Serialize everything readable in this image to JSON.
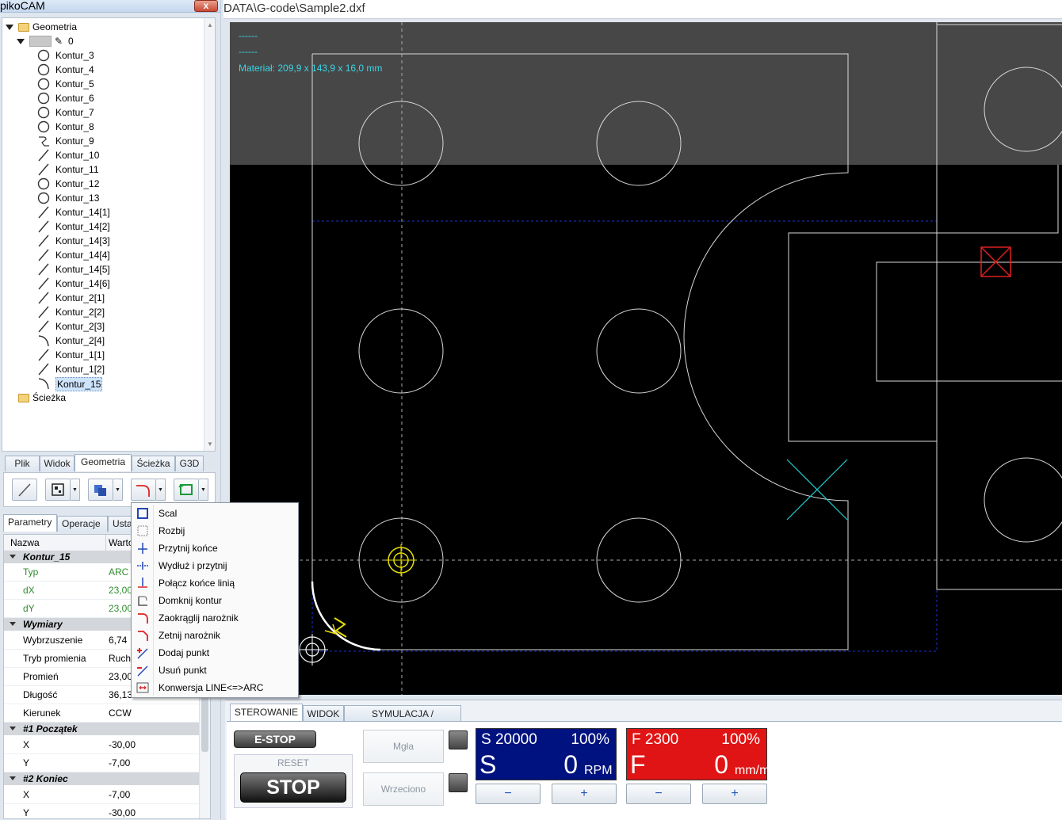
{
  "app": {
    "title": "pikoCAM",
    "close_label": "x"
  },
  "path": "DATA\\G-code\\Sample2.dxf",
  "tree": {
    "root": "Geometria",
    "layer": "0",
    "items": [
      "Kontur_3",
      "Kontur_4",
      "Kontur_5",
      "Kontur_6",
      "Kontur_7",
      "Kontur_8",
      "Kontur_9",
      "Kontur_10",
      "Kontur_11",
      "Kontur_12",
      "Kontur_13",
      "Kontur_14[1]",
      "Kontur_14[2]",
      "Kontur_14[3]",
      "Kontur_14[4]",
      "Kontur_14[5]",
      "Kontur_14[6]",
      "Kontur_2[1]",
      "Kontur_2[2]",
      "Kontur_2[3]",
      "Kontur_2[4]",
      "Kontur_1[1]",
      "Kontur_1[2]",
      "Kontur_15"
    ],
    "item_icons": [
      "circle",
      "circle",
      "circle",
      "circle",
      "circle",
      "circle",
      "path",
      "line",
      "line",
      "circle",
      "circle",
      "line",
      "line",
      "line",
      "line",
      "line",
      "line",
      "line",
      "line",
      "line",
      "arc",
      "line",
      "line",
      "arc"
    ],
    "selected": "Kontur_15",
    "second_root": "Ścieżka"
  },
  "top_tabs": [
    "Plik",
    "Widok",
    "Geometria",
    "Ścieżka",
    "G3D"
  ],
  "top_tab_active": "Geometria",
  "prop_tabs": [
    "Parametry",
    "Operacje",
    "Ustaw"
  ],
  "prop_tab_active": "Parametry",
  "props": {
    "col_name": "Nazwa",
    "col_value": "Wartość",
    "object": "Kontur_15",
    "rows1": [
      {
        "name": "Typ",
        "value": "ARC"
      },
      {
        "name": "dX",
        "value": "23,00"
      },
      {
        "name": "dY",
        "value": "23,00"
      }
    ],
    "cat2": "Wymiary",
    "rows2": [
      {
        "name": "Wybrzuszenie",
        "value": "6,74"
      },
      {
        "name": "Tryb promienia",
        "value": "Ruch"
      },
      {
        "name": "Promień",
        "value": "23,00"
      },
      {
        "name": "Długość",
        "value": "36,13"
      },
      {
        "name": "Kierunek",
        "value": "CCW"
      }
    ],
    "cat3": "#1 Początek",
    "rows3": [
      {
        "name": "X",
        "value": "-30,00"
      },
      {
        "name": "Y",
        "value": "-7,00"
      }
    ],
    "cat4": "#2 Koniec",
    "rows4": [
      {
        "name": "X",
        "value": "-7,00"
      },
      {
        "name": "Y",
        "value": "-30,00"
      }
    ]
  },
  "menu": {
    "items": [
      "Scal",
      "Rozbij",
      "Przytnij końce",
      "Wydłuż i przytnij",
      "Połącz końce linią",
      "Domknij kontur",
      "Zaokrąglij narożnik",
      "Zetnij narożnik",
      "Dodaj punkt",
      "Usuń punkt",
      "Konwersja LINE<=>ARC"
    ]
  },
  "canvas": {
    "line1": "------",
    "line2": "------",
    "material": "Materiał: 209,9 x 143,9 x 16,0 mm"
  },
  "bottom": {
    "tabs": [
      "STEROWANIE",
      "WIDOK",
      "SYMULACJA / NARZĘDZIA"
    ],
    "estop": "E-STOP",
    "reset": "RESET",
    "stop": "STOP",
    "mist": "Mgła",
    "spindle": "Wrzeciono",
    "s_panel": {
      "top": "S 20000",
      "pct": "100%",
      "big": "S",
      "val": "0",
      "unit": "RPM",
      "color": "#00127f"
    },
    "f_panel": {
      "top": "F 2300",
      "pct": "100%",
      "big": "F",
      "val": "0",
      "unit": "mm/m",
      "color": "#e01414"
    },
    "minus": "−",
    "plus": "+"
  }
}
